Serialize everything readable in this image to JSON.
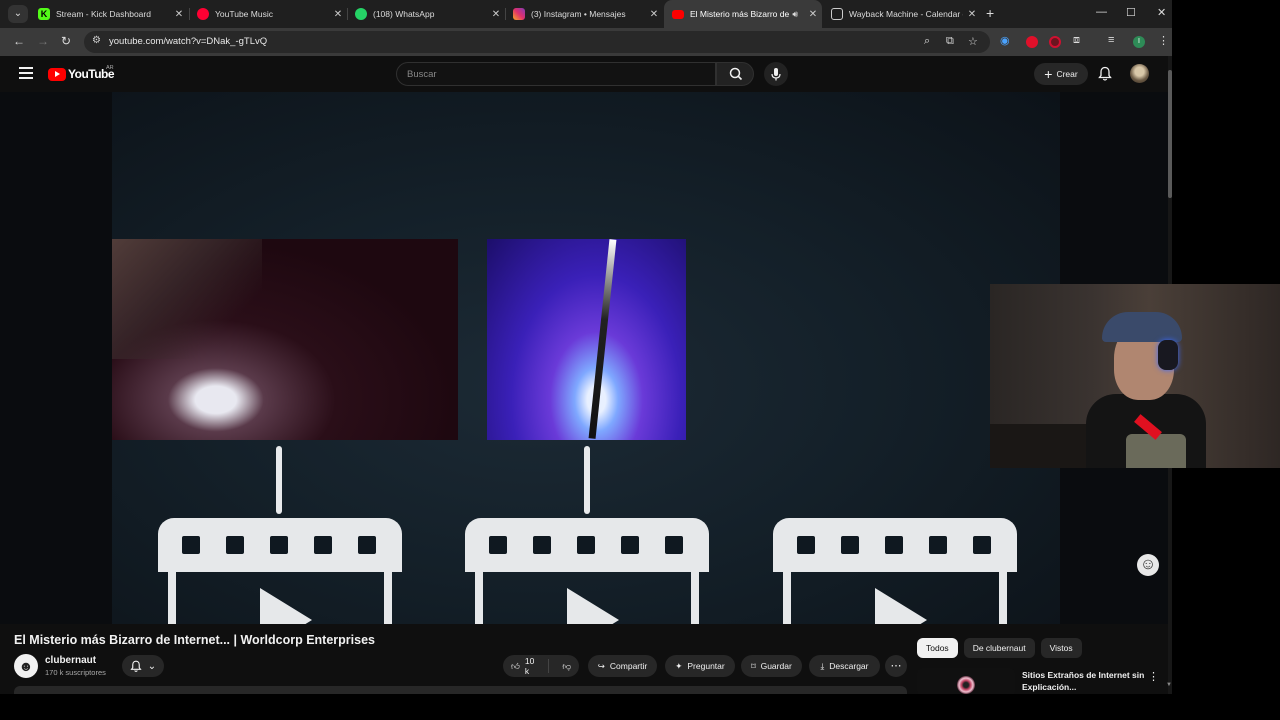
{
  "browser": {
    "tabs": [
      {
        "title": "Stream - Kick Dashboard",
        "favicon_color": "#53fc18",
        "favicon_glyph": "K"
      },
      {
        "title": "YouTube Music",
        "favicon_color": "#ff0033",
        "favicon_glyph": "▶"
      },
      {
        "title": "(108) WhatsApp",
        "favicon_color": "#25d366",
        "favicon_glyph": "✆"
      },
      {
        "title": "(3) Instagram • Mensajes",
        "favicon_color": "#e1306c",
        "favicon_glyph": "◎"
      },
      {
        "title": "El Misterio más Bizarro de I",
        "favicon_color": "#ff0000",
        "favicon_glyph": "▶",
        "active": true
      },
      {
        "title": "Wayback Machine - Calendar o",
        "favicon_color": "#cccccc",
        "favicon_glyph": "▦"
      }
    ],
    "address": {
      "url": "youtube.com/watch?v=DNak_-gTLvQ"
    },
    "icons": {
      "back": "arrow-left-icon",
      "forward": "arrow-right-icon",
      "reload": "reload-icon",
      "zoom": "zoom-icon",
      "install": "install-app-icon",
      "bookmark": "star-icon",
      "extensions": "puzzle-icon",
      "media": "media-controls-icon",
      "profile_letter": "I"
    }
  },
  "youtube": {
    "logo_text": "YouTube",
    "country_code": "AR",
    "search_placeholder": "Buscar",
    "create_label": "Crear",
    "video": {
      "title": "El Misterio más Bizarro de Internet... | Worldcorp Enterprises",
      "channel": "clubernaut",
      "subscribers": "170 k suscriptores",
      "likes": "10 k",
      "actions": {
        "share": "Compartir",
        "ask": "Preguntar",
        "save": "Guardar",
        "download": "Descargar"
      }
    },
    "chips": [
      "Todos",
      "De clubernaut",
      "Vistos"
    ],
    "recommendation": {
      "title": "Sitios Extraños de Internet sin Explicación..."
    }
  },
  "colors": {
    "accent_red": "#ff0000",
    "background": "#0f0f0f",
    "surface": "#272727",
    "text": "#f1f1f1"
  }
}
